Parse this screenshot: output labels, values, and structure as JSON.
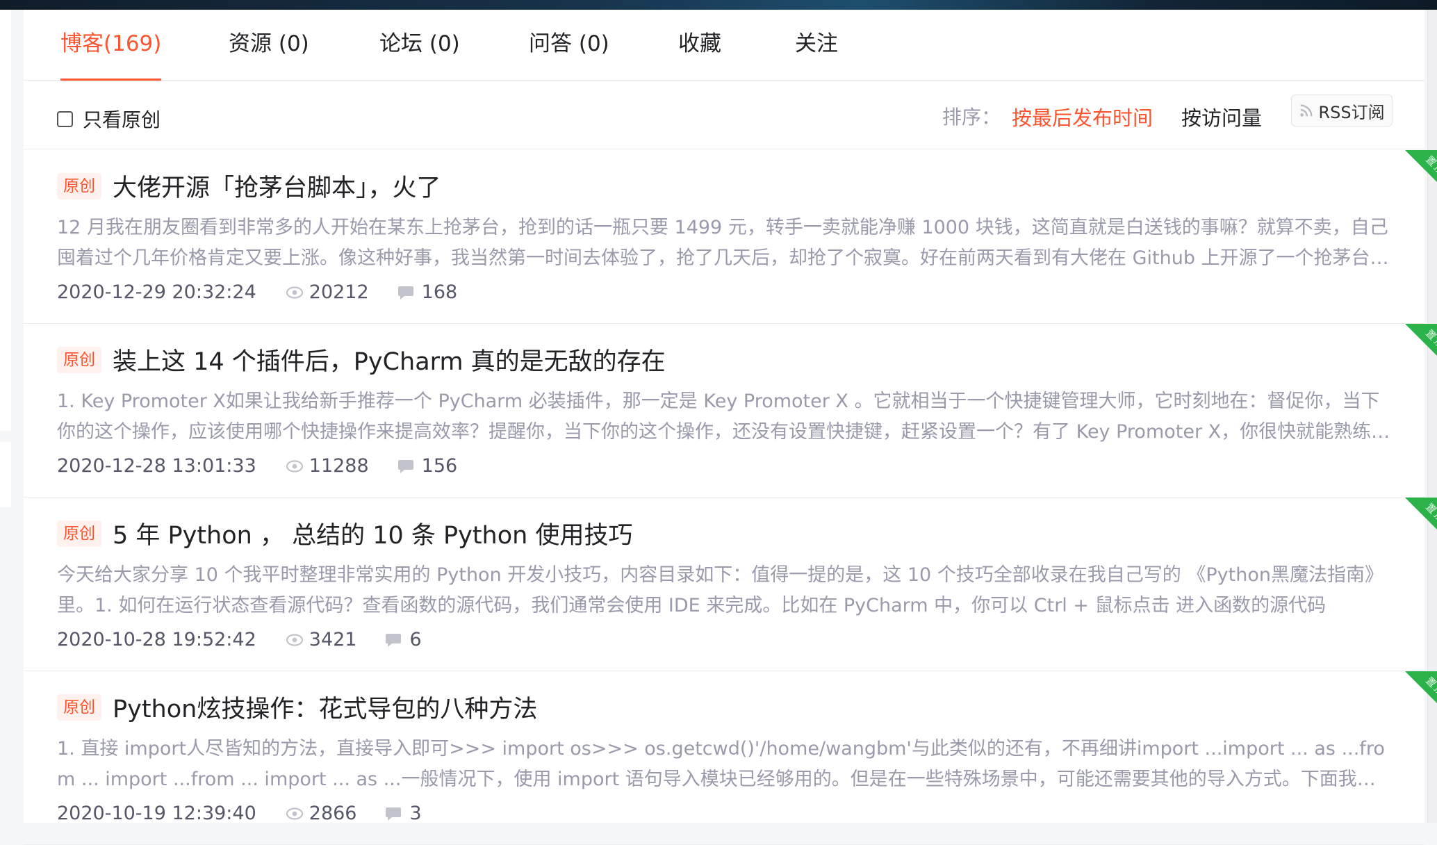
{
  "tabs": [
    {
      "label": "博客(169)",
      "active": true
    },
    {
      "label": "资源 (0)",
      "active": false
    },
    {
      "label": "论坛 (0)",
      "active": false
    },
    {
      "label": "问答 (0)",
      "active": false
    },
    {
      "label": "收藏",
      "active": false
    },
    {
      "label": "关注",
      "active": false
    }
  ],
  "filter": {
    "only_original_label": "只看原创",
    "only_original_checked": false,
    "sort_label": "排序：",
    "sort_by_latest": "按最后发布时间",
    "sort_by_views": "按访问量",
    "rss_label": "RSS订阅"
  },
  "colors": {
    "accent": "#fc5531",
    "pin": "#2bb34a",
    "muted": "#999aaa"
  },
  "pin_label": "置顶",
  "articles": [
    {
      "badge": "原创",
      "title": "大佬开源「抢茅台脚本」，火了",
      "summary": "12 月我在朋友圈看到非常多的人开始在某东上抢茅台，抢到的话一瓶只要 1499 元，转手一卖就能净赚 1000 块钱，这简直就是白送钱的事嘛？就算不卖，自己囤着过个几年价格肯定又要上涨。像这种好事，我当然第一时间去体验了，抢了几天后，却抢了个寂寞。好在前两天看到有大佬在 Github 上开源了一个抢茅台的脚本",
      "date": "2020-12-29 20:32:24",
      "views": "20212",
      "comments": "168",
      "pinned": true
    },
    {
      "badge": "原创",
      "title": "装上这 14 个插件后，PyCharm 真的是无敌的存在",
      "summary": "1. Key Promoter X如果让我给新手推荐一个 PyCharm 必装插件，那一定是 Key Promoter X 。它就相当于一个快捷键管理大师，它时刻地在：督促你，当下你的这个操作，应该使用哪个快捷操作来提高效率？提醒你，当下你的这个操作，还没有设置快捷键，赶紧设置一个？有了 Key Promoter X，你很快就能熟练使用快捷键",
      "date": "2020-12-28 13:01:33",
      "views": "11288",
      "comments": "156",
      "pinned": true
    },
    {
      "badge": "原创",
      "title": "5 年 Python ， 总结的 10 条 Python 使用技巧",
      "summary": "今天给大家分享 10 个我平时整理非常实用的 Python 开发小技巧，内容目录如下：值得一提的是，这 10 个技巧全部收录在我自己写的 《Python黑魔法指南》里。1. 如何在运行状态查看源代码？查看函数的源代码，我们通常会使用 IDE 来完成。比如在 PyCharm 中，你可以 Ctrl + 鼠标点击 进入函数的源代码",
      "date": "2020-10-28 19:52:42",
      "views": "3421",
      "comments": "6",
      "pinned": true
    },
    {
      "badge": "原创",
      "title": "Python炫技操作：花式导包的八种方法",
      "summary": "1. 直接 import人尽皆知的方法，直接导入即可>>> import os>>> os.getcwd()'/home/wangbm'与此类似的还有，不再细讲import ...import ... as ...from ... import ...from ... import ... as ...一般情况下，使用 import 语句导入模块已经够用的。但是在一些特殊场景中，可能还需要其他的导入方式。下面我会一一介绍",
      "date": "2020-10-19 12:39:40",
      "views": "2866",
      "comments": "3",
      "pinned": true
    }
  ]
}
